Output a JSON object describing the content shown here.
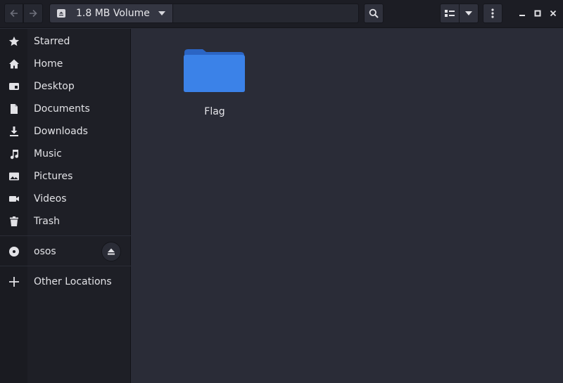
{
  "header": {
    "path_label": "1.8 MB Volume"
  },
  "sidebar": {
    "items": [
      {
        "label": "Starred",
        "icon": "star-icon"
      },
      {
        "label": "Home",
        "icon": "home-icon"
      },
      {
        "label": "Desktop",
        "icon": "desktop-icon"
      },
      {
        "label": "Documents",
        "icon": "document-icon"
      },
      {
        "label": "Downloads",
        "icon": "download-icon"
      },
      {
        "label": "Music",
        "icon": "music-icon"
      },
      {
        "label": "Pictures",
        "icon": "picture-icon"
      },
      {
        "label": "Videos",
        "icon": "video-icon"
      },
      {
        "label": "Trash",
        "icon": "trash-icon"
      }
    ],
    "devices": [
      {
        "label": "osos",
        "icon": "disc-icon"
      }
    ],
    "other_locations": "Other Locations"
  },
  "main": {
    "files": [
      {
        "name": "Flag",
        "type": "folder"
      }
    ]
  },
  "colors": {
    "folder": "#3b82e8",
    "folder_tab": "#2b65c4",
    "background": "#2a2c37",
    "sidebar": "#1e1f26"
  }
}
